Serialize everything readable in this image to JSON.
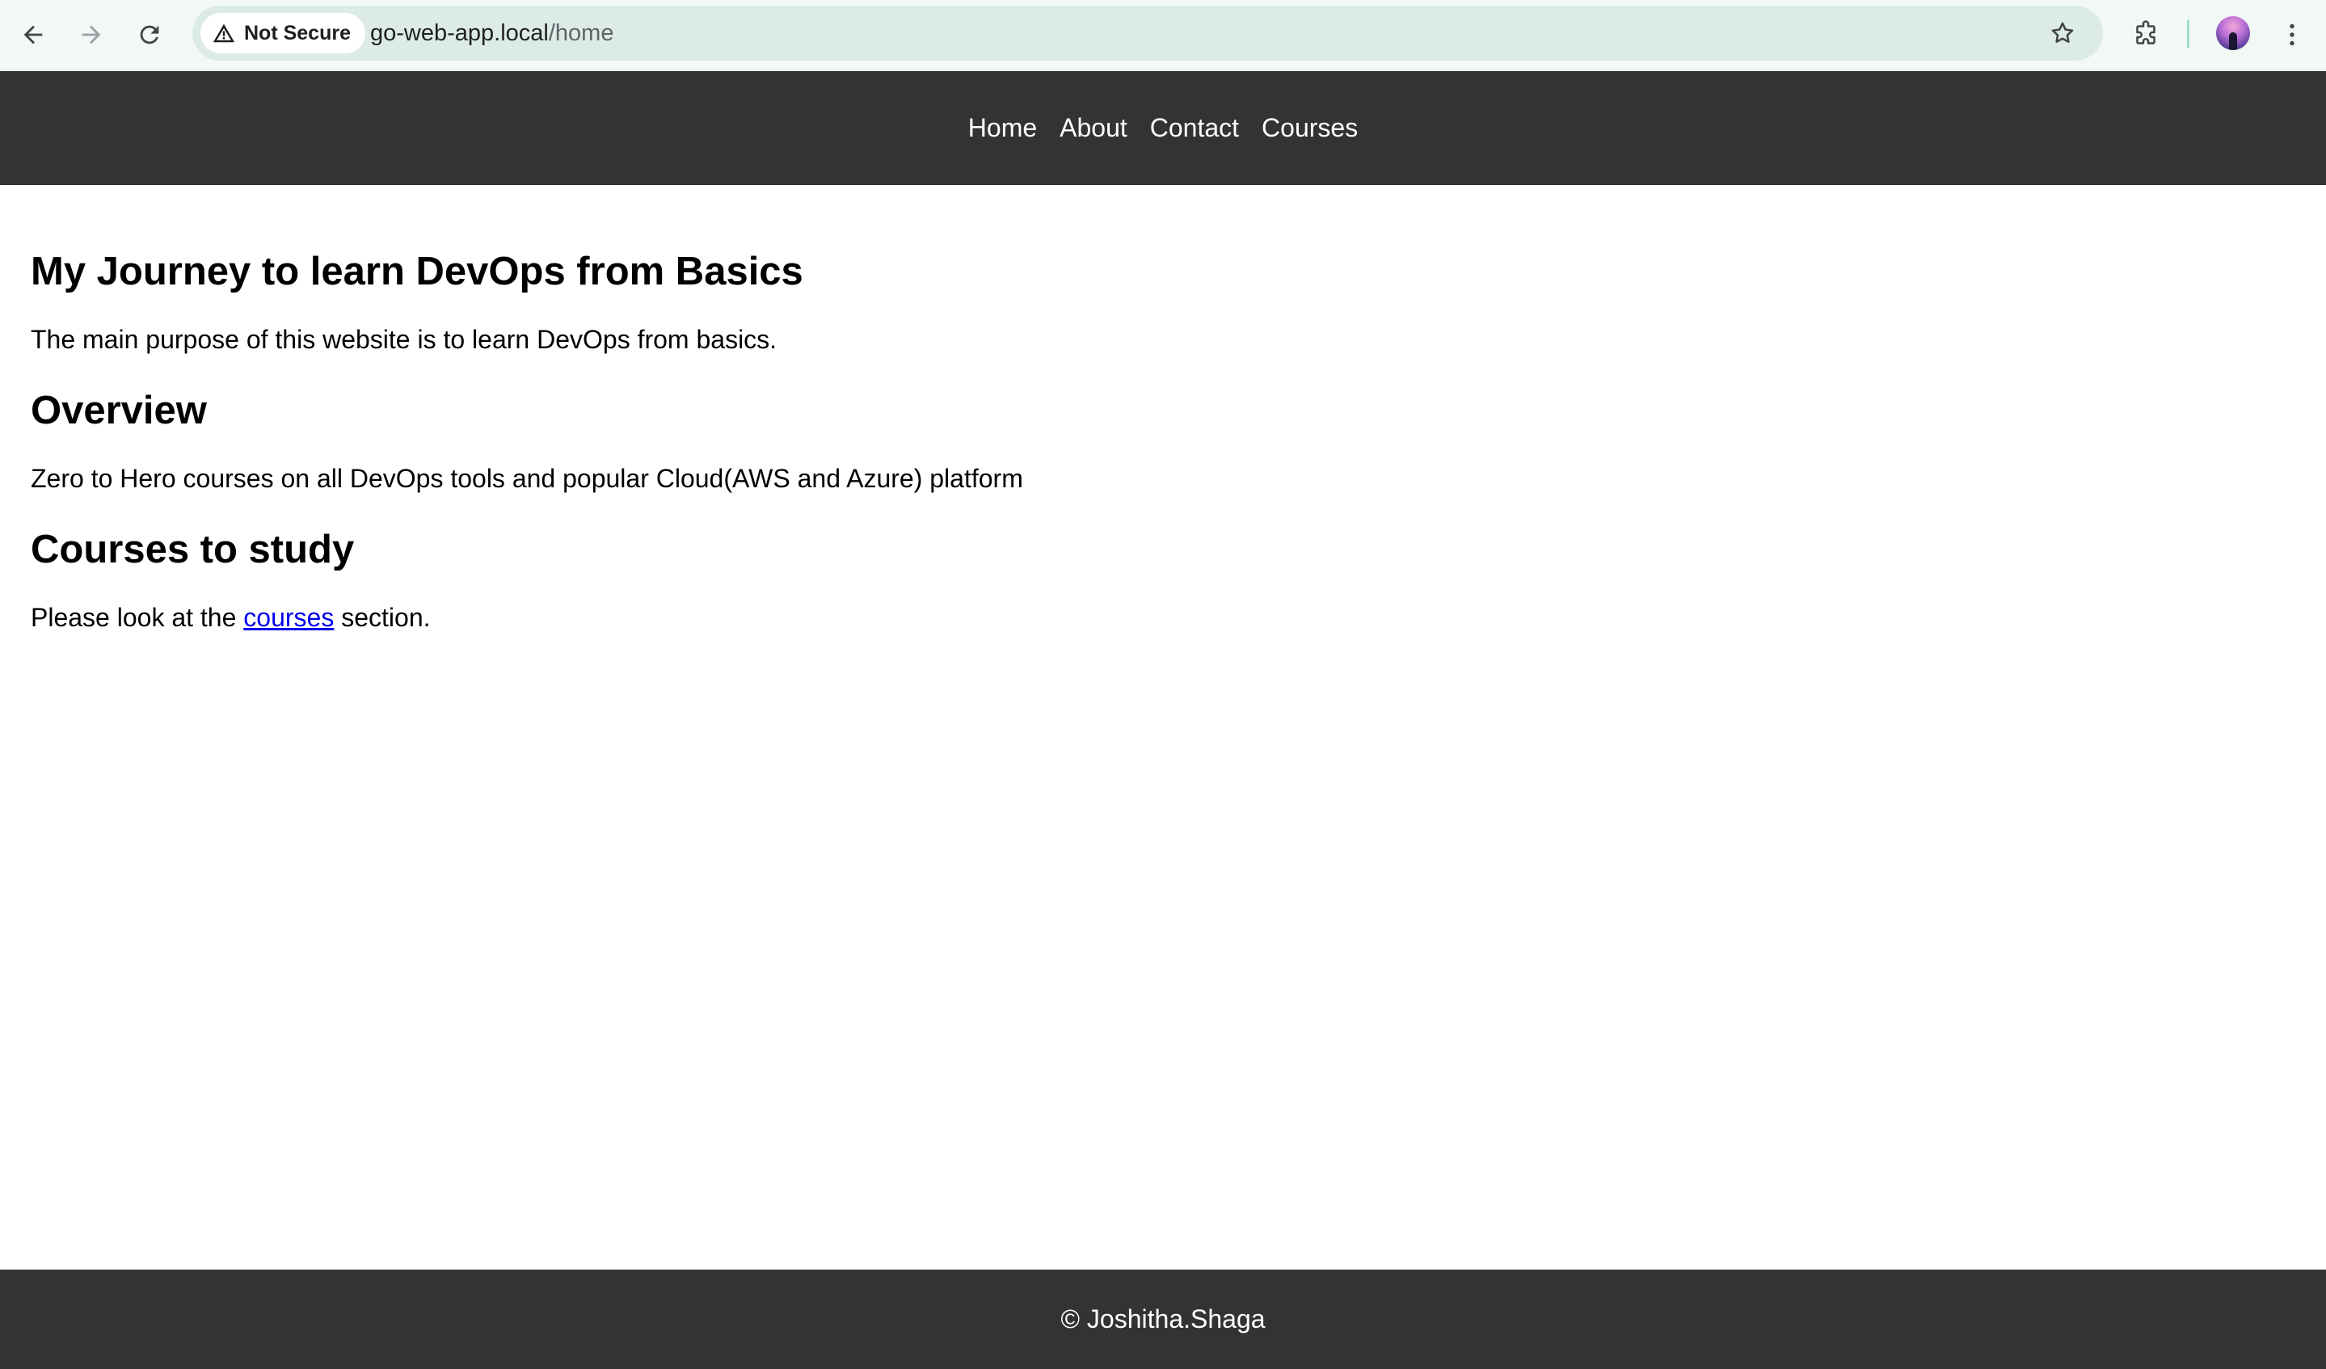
{
  "browser": {
    "security_label": "Not Secure",
    "url_host": "go-web-app.local",
    "url_path": "/home",
    "icons": {
      "back": "back-arrow-icon",
      "forward": "forward-arrow-icon",
      "reload": "reload-icon",
      "security": "warning-triangle-icon",
      "bookmark": "star-icon",
      "extensions": "puzzle-icon",
      "menu": "kebab-menu-icon"
    }
  },
  "nav": {
    "items": [
      {
        "label": "Home"
      },
      {
        "label": "About"
      },
      {
        "label": "Contact"
      },
      {
        "label": "Courses"
      }
    ]
  },
  "main": {
    "title": "My Journey to learn DevOps from Basics",
    "intro": "The main purpose of this website is to learn DevOps from basics.",
    "overview_heading": "Overview",
    "overview_text": "Zero to Hero courses on all DevOps tools and popular Cloud(AWS and Azure) platform",
    "courses_heading": "Courses to study",
    "courses_text_before": "Please look at the ",
    "courses_link": "courses",
    "courses_text_after": " section."
  },
  "footer": {
    "text": "© Joshitha.Shaga"
  },
  "colors": {
    "nav_bg": "#333333",
    "link": "#0000ee",
    "chrome_bg": "#f2f8f5",
    "omnibox_bg": "#dcebe5"
  }
}
